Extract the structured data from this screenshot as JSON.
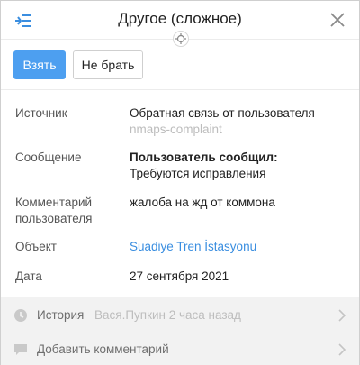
{
  "header": {
    "title": "Другое (сложное)",
    "collapse_icon": "collapse-panel-icon",
    "close_icon": "close-icon"
  },
  "actions": {
    "take_label": "Взять",
    "skip_label": "Не брать"
  },
  "fields": {
    "source": {
      "label": "Источник",
      "value": "Обратная связь от пользователя",
      "sub_value": "nmaps-complaint"
    },
    "message": {
      "label": "Сообщение",
      "value_bold": "Пользователь сообщил:",
      "value": "Требуются исправления"
    },
    "comment": {
      "label_line1": "Комментарий",
      "label_line2": "пользователя",
      "value": "жалоба на жд от коммона"
    },
    "object": {
      "label": "Объект",
      "value": "Suadiye Tren İstasyonu"
    },
    "date": {
      "label": "Дата",
      "value": "27 сентября 2021"
    }
  },
  "footer": {
    "history": {
      "label": "История",
      "meta": "Вася.Пупкин 2 часа назад"
    },
    "add_comment": {
      "label": "Добавить комментарий"
    }
  },
  "colors": {
    "accent": "#4d9ff0",
    "link": "#3a8ee0",
    "muted": "#bdbdbd",
    "footer_bg": "#f2f2f2"
  }
}
